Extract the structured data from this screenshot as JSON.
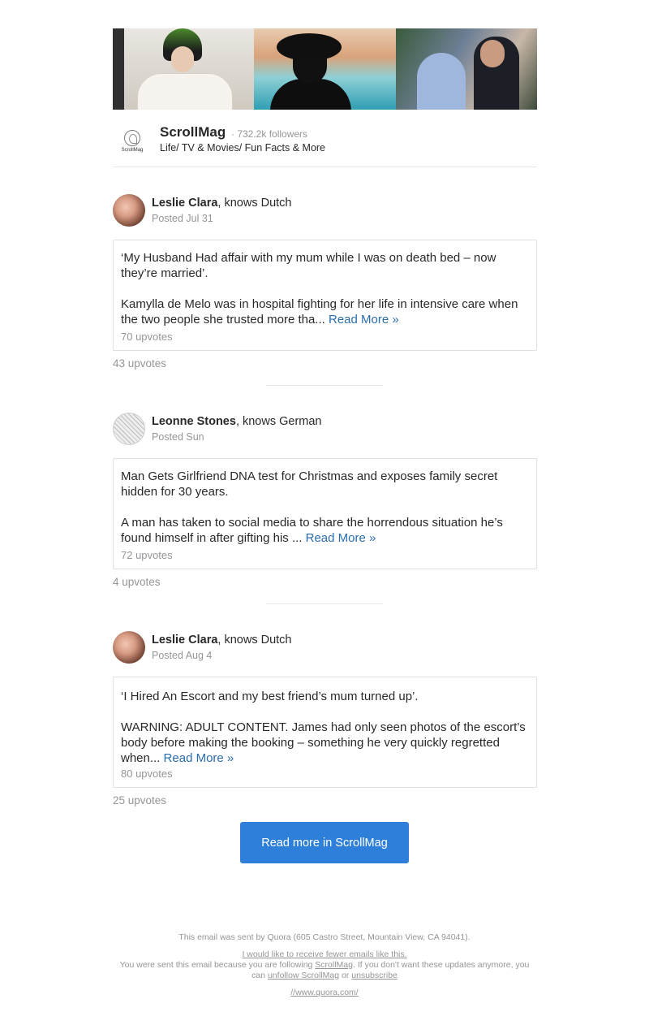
{
  "publication": {
    "name": "ScrollMag",
    "followers": "· 732.2k followers",
    "description": "Life/ TV & Movies/ Fun Facts & More",
    "logo_text": "ScrollMag"
  },
  "posts": [
    {
      "author": "Leslie Clara",
      "credential": ", knows Dutch",
      "posted": "Posted Jul 31",
      "headline": "‘My Husband Had affair with my mum while I was on death bed – now they’re married’.",
      "excerpt": "Kamylla de Melo was in hospital fighting for her life in intensive care when the two people she trusted more tha...",
      "read_more": "Read More »",
      "card_upvotes": "70 upvotes",
      "upvotes": "43 upvotes"
    },
    {
      "author": "Leonne Stones",
      "credential": ", knows German",
      "posted": "Posted Sun",
      "headline": "Man Gets Girlfriend DNA test for Christmas and exposes family secret hidden for 30 years.",
      "excerpt": "A man has taken to social media to share the horrendous situation he’s found himself in after gifting his ...",
      "read_more": "Read More »",
      "card_upvotes": "72 upvotes",
      "upvotes": "4 upvotes"
    },
    {
      "author": "Leslie Clara",
      "credential": ", knows Dutch",
      "posted": "Posted Aug 4",
      "headline": "‘I Hired An Escort and my best friend’s mum turned up’.",
      "excerpt": "WARNING: ADULT CONTENT. James had only seen photos of the escort’s body before making the booking – something he very quickly regretted when...",
      "read_more": "Read More »",
      "card_upvotes": "80 upvotes",
      "upvotes": "25 upvotes"
    }
  ],
  "cta": {
    "label": "Read more in ScrollMag"
  },
  "footer": {
    "sent_by": "This email was sent by Quora (605 Castro Street, Mountain View, CA 94041).",
    "fewer_emails": "I would like to receive fewer emails like this.",
    "reason_prefix": "You were sent this email because you are following ",
    "reason_link": "ScrollMag",
    "reason_suffix": ". If you don't want these updates anymore, you",
    "reason_line2_prefix": "can ",
    "unfollow": "unfollow ScrollMag",
    "or": " or ",
    "unsubscribe": "unsubscribe",
    "site_link": "//www.quora.com/"
  },
  "colors": {
    "cta_background": "#2e7fd9",
    "read_more": "#2b6dad",
    "muted_text": "#939598"
  }
}
